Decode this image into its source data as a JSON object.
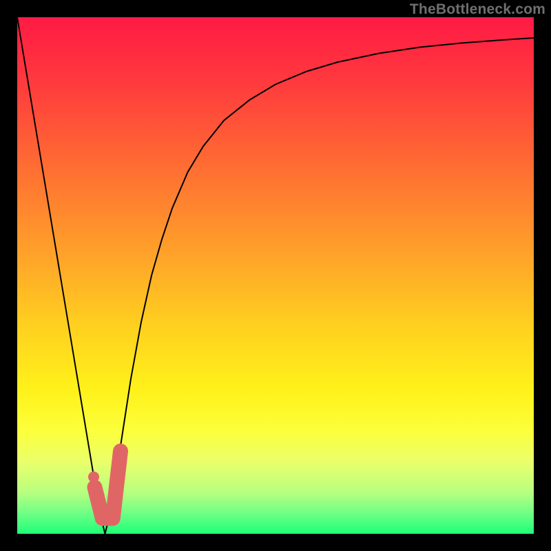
{
  "watermark": "TheBottleneck.com",
  "chart_data": {
    "type": "line",
    "title": "",
    "xlabel": "",
    "ylabel": "",
    "xlim": [
      0,
      100
    ],
    "ylim": [
      0,
      100
    ],
    "grid": false,
    "legend": false,
    "gradient_stops": [
      {
        "offset": 0.0,
        "color": "#ff1a44"
      },
      {
        "offset": 0.13,
        "color": "#ff3b3d"
      },
      {
        "offset": 0.28,
        "color": "#ff6a33"
      },
      {
        "offset": 0.45,
        "color": "#ff9f2a"
      },
      {
        "offset": 0.6,
        "color": "#ffd11f"
      },
      {
        "offset": 0.72,
        "color": "#fff11a"
      },
      {
        "offset": 0.8,
        "color": "#fcff3a"
      },
      {
        "offset": 0.86,
        "color": "#eaff6a"
      },
      {
        "offset": 0.92,
        "color": "#b8ff80"
      },
      {
        "offset": 0.96,
        "color": "#6fff85"
      },
      {
        "offset": 1.0,
        "color": "#1eff78"
      }
    ],
    "series": [
      {
        "name": "bottleneck-curve",
        "x": [
          0,
          2,
          4,
          6,
          8,
          10,
          12,
          14,
          15,
          16,
          17,
          18,
          19,
          20,
          22,
          24,
          26,
          28,
          30,
          33,
          36,
          40,
          45,
          50,
          56,
          62,
          70,
          78,
          86,
          94,
          100
        ],
        "y": [
          100,
          88,
          76,
          64,
          52,
          40,
          28,
          16,
          10,
          4,
          0,
          4,
          10,
          17,
          30,
          41,
          50,
          57,
          63,
          70,
          75,
          80,
          84,
          87,
          89.5,
          91.3,
          93,
          94.2,
          95,
          95.6,
          96
        ]
      }
    ],
    "annotations": {
      "optimal_marker": {
        "description": "J-shaped highlight at curve minimum",
        "points_xy": [
          [
            15.0,
            9
          ],
          [
            16.5,
            3
          ],
          [
            18.5,
            3
          ],
          [
            20.0,
            16
          ]
        ],
        "dot_xy": [
          14.8,
          11
        ],
        "color": "#E06666"
      }
    }
  }
}
